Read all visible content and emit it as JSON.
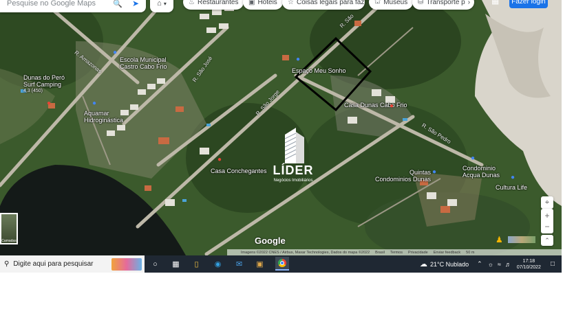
{
  "search": {
    "placeholder": "Pesquise no Google Maps"
  },
  "chips": [
    {
      "icon": "restaurant-icon",
      "label": "Restaurantes"
    },
    {
      "icon": "hotel-icon",
      "label": "Hotéis"
    },
    {
      "icon": "things-to-do-icon",
      "label": "Coisas legais para fazer"
    },
    {
      "icon": "museum-icon",
      "label": "Museus"
    },
    {
      "icon": "transit-icon",
      "label": "Transporte p"
    }
  ],
  "signin_label": "Fazer login",
  "places": [
    {
      "name": "Dunas do Peró",
      "sub": "Surf Camping"
    },
    {
      "name": "Escola Municipal",
      "sub": "Castro Cabo Frio"
    },
    {
      "name": "Espaço Meu Sonho"
    },
    {
      "name": "Aquamar",
      "sub": "Hidroginástica"
    },
    {
      "name": "Casa Dunas Cabo Frio"
    },
    {
      "name": "Casa Conchegantes"
    },
    {
      "name": "Condominio",
      "sub": "Acqua Dunas"
    },
    {
      "name": "Cultura Life"
    },
    {
      "name": "Quintas Condominios Dunas"
    }
  ],
  "place_rating": "4,3 (450)",
  "streets": [
    "R. Amazonas",
    "R. São José",
    "R. São Jorge",
    "R. São Pedro",
    "R. São"
  ],
  "logo": {
    "name": "LÍDER",
    "tagline": "Negócios Imobiliários"
  },
  "watermark": "Google",
  "attribution": [
    "Imagens ©2022 CNES / Airbus, Maxar Technologies, Dados do mapa ©2022",
    "Brasil",
    "Termos",
    "Privacidade",
    "Enviar feedback",
    "50 m"
  ],
  "layers_label": "Camadas",
  "taskbar": {
    "search_placeholder": "Digite aqui para pesquisar",
    "weather": "21°C Nublado",
    "time": "17:18",
    "date": "07/10/2022"
  },
  "colors": {
    "accent": "#1a73e8",
    "pin_red": "#ea4335",
    "pin_blue": "#4285f4",
    "taskbar": "#1f2833"
  }
}
